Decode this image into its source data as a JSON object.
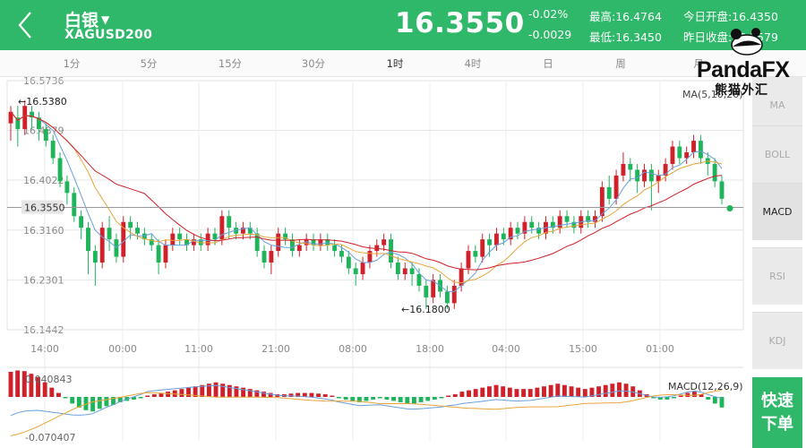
{
  "header": {
    "name": "白银",
    "code": "XAGUSD200",
    "price": "16.3550",
    "change_pct": "-0.02%",
    "change_abs": "-0.0029",
    "high_label": "最高:",
    "high": "16.4764",
    "low_label": "最低:",
    "low": "16.3450",
    "open_label": "今日开盘:",
    "open": "16.4350",
    "prev_close_label": "昨日收盘:",
    "prev_close": "16.3579"
  },
  "tabs": [
    "1分",
    "5分",
    "15分",
    "30分",
    "1时",
    "4时",
    "日",
    "周",
    "月"
  ],
  "active_tab": "1时",
  "logo": {
    "brand": "PandaFX",
    "brand_cn": "熊猫外汇"
  },
  "side_buttons": [
    "MA",
    "BOLL",
    "MACD",
    "RSI",
    "KDJ"
  ],
  "active_side": "MACD",
  "quick_order": [
    "快速",
    "下单"
  ],
  "colors": {
    "accent": "#2fb86a",
    "up": "#d0202a",
    "down": "#1db45a",
    "ma5": "#6aa0dc",
    "ma10": "#e8a53a",
    "ma20": "#d0202a"
  },
  "chart_data": {
    "type": "candlestick",
    "y_ticks": [
      "16.5736",
      "16.4879",
      "16.4022",
      "16.3160",
      "16.2301",
      "16.1442"
    ],
    "ylim": [
      16.1442,
      16.5736
    ],
    "x_ticks": [
      "14:00",
      "00:00",
      "11:00",
      "21:00",
      "08:00",
      "18:00",
      "04:00",
      "15:00",
      "01:00"
    ],
    "current_price_label": "16.3550",
    "current_price": 16.355,
    "max_label": "←16.5380",
    "min_label": "←16.1800",
    "ma_label": "MA(5,10,20)",
    "macd_label": "MACD(12,26,9)",
    "macd_top_label": "0.040843",
    "macd_bottom_label": "-0.070407",
    "candles": [
      [
        16.5,
        16.52,
        16.47,
        16.53
      ],
      [
        16.51,
        16.49,
        16.46,
        16.53
      ],
      [
        16.49,
        16.53,
        16.48,
        16.54
      ],
      [
        16.52,
        16.51,
        16.49,
        16.53
      ],
      [
        16.51,
        16.49,
        16.47,
        16.52
      ],
      [
        16.49,
        16.47,
        16.46,
        16.5
      ],
      [
        16.47,
        16.44,
        16.43,
        16.48
      ],
      [
        16.44,
        16.4,
        16.39,
        16.45
      ],
      [
        16.4,
        16.38,
        16.36,
        16.41
      ],
      [
        16.38,
        16.34,
        16.33,
        16.39
      ],
      [
        16.34,
        16.32,
        16.3,
        16.35
      ],
      [
        16.32,
        16.28,
        16.24,
        16.33
      ],
      [
        16.28,
        16.26,
        16.22,
        16.29
      ],
      [
        16.26,
        16.32,
        16.25,
        16.33
      ],
      [
        16.32,
        16.3,
        16.28,
        16.34
      ],
      [
        16.3,
        16.27,
        16.26,
        16.31
      ],
      [
        16.27,
        16.33,
        16.26,
        16.34
      ],
      [
        16.33,
        16.32,
        16.3,
        16.34
      ],
      [
        16.32,
        16.31,
        16.3,
        16.33
      ],
      [
        16.31,
        16.3,
        16.29,
        16.32
      ],
      [
        16.3,
        16.29,
        16.28,
        16.31
      ],
      [
        16.29,
        16.26,
        16.24,
        16.3
      ],
      [
        16.26,
        16.29,
        16.25,
        16.3
      ],
      [
        16.29,
        16.31,
        16.28,
        16.32
      ],
      [
        16.31,
        16.3,
        16.29,
        16.32
      ],
      [
        16.3,
        16.29,
        16.28,
        16.31
      ],
      [
        16.29,
        16.3,
        16.28,
        16.31
      ],
      [
        16.3,
        16.29,
        16.28,
        16.31
      ],
      [
        16.29,
        16.31,
        16.28,
        16.32
      ],
      [
        16.31,
        16.3,
        16.29,
        16.32
      ],
      [
        16.3,
        16.34,
        16.29,
        16.35
      ],
      [
        16.34,
        16.32,
        16.3,
        16.35
      ],
      [
        16.32,
        16.31,
        16.3,
        16.33
      ],
      [
        16.31,
        16.32,
        16.3,
        16.33
      ],
      [
        16.32,
        16.31,
        16.3,
        16.33
      ],
      [
        16.31,
        16.28,
        16.27,
        16.32
      ],
      [
        16.28,
        16.26,
        16.25,
        16.29
      ],
      [
        16.26,
        16.28,
        16.24,
        16.29
      ],
      [
        16.28,
        16.31,
        16.27,
        16.32
      ],
      [
        16.31,
        16.3,
        16.29,
        16.32
      ],
      [
        16.3,
        16.28,
        16.27,
        16.31
      ],
      [
        16.28,
        16.29,
        16.27,
        16.3
      ],
      [
        16.29,
        16.3,
        16.28,
        16.31
      ],
      [
        16.3,
        16.29,
        16.28,
        16.31
      ],
      [
        16.29,
        16.3,
        16.28,
        16.31
      ],
      [
        16.3,
        16.29,
        16.28,
        16.31
      ],
      [
        16.29,
        16.28,
        16.27,
        16.3
      ],
      [
        16.28,
        16.27,
        16.26,
        16.29
      ],
      [
        16.27,
        16.25,
        16.24,
        16.28
      ],
      [
        16.25,
        16.24,
        16.22,
        16.26
      ],
      [
        16.24,
        16.26,
        16.23,
        16.27
      ],
      [
        16.26,
        16.28,
        16.25,
        16.29
      ],
      [
        16.28,
        16.29,
        16.27,
        16.3
      ],
      [
        16.29,
        16.3,
        16.28,
        16.31
      ],
      [
        16.3,
        16.26,
        16.25,
        16.31
      ],
      [
        16.26,
        16.24,
        16.23,
        16.27
      ],
      [
        16.24,
        16.25,
        16.23,
        16.26
      ],
      [
        16.25,
        16.24,
        16.22,
        16.26
      ],
      [
        16.24,
        16.22,
        16.21,
        16.25
      ],
      [
        16.22,
        16.2,
        16.18,
        16.23
      ],
      [
        16.2,
        16.23,
        16.19,
        16.24
      ],
      [
        16.23,
        16.21,
        16.2,
        16.24
      ],
      [
        16.21,
        16.19,
        16.18,
        16.22
      ],
      [
        16.19,
        16.22,
        16.18,
        16.23
      ],
      [
        16.22,
        16.25,
        16.21,
        16.26
      ],
      [
        16.25,
        16.28,
        16.24,
        16.29
      ],
      [
        16.28,
        16.27,
        16.26,
        16.29
      ],
      [
        16.27,
        16.3,
        16.26,
        16.31
      ],
      [
        16.3,
        16.29,
        16.27,
        16.31
      ],
      [
        16.29,
        16.31,
        16.28,
        16.32
      ],
      [
        16.31,
        16.3,
        16.29,
        16.32
      ],
      [
        16.3,
        16.32,
        16.29,
        16.33
      ],
      [
        16.32,
        16.31,
        16.3,
        16.33
      ],
      [
        16.31,
        16.33,
        16.3,
        16.34
      ],
      [
        16.33,
        16.32,
        16.31,
        16.34
      ],
      [
        16.32,
        16.31,
        16.3,
        16.33
      ],
      [
        16.31,
        16.33,
        16.3,
        16.34
      ],
      [
        16.33,
        16.32,
        16.31,
        16.34
      ],
      [
        16.32,
        16.34,
        16.31,
        16.35
      ],
      [
        16.34,
        16.33,
        16.32,
        16.35
      ],
      [
        16.33,
        16.32,
        16.31,
        16.34
      ],
      [
        16.32,
        16.34,
        16.31,
        16.35
      ],
      [
        16.34,
        16.33,
        16.32,
        16.35
      ],
      [
        16.33,
        16.34,
        16.32,
        16.35
      ],
      [
        16.34,
        16.39,
        16.33,
        16.4
      ],
      [
        16.39,
        16.37,
        16.36,
        16.41
      ],
      [
        16.37,
        16.41,
        16.36,
        16.42
      ],
      [
        16.41,
        16.43,
        16.4,
        16.45
      ],
      [
        16.43,
        16.42,
        16.4,
        16.44
      ],
      [
        16.42,
        16.4,
        16.38,
        16.43
      ],
      [
        16.4,
        16.42,
        16.39,
        16.43
      ],
      [
        16.42,
        16.4,
        16.35,
        16.43
      ],
      [
        16.4,
        16.41,
        16.38,
        16.42
      ],
      [
        16.41,
        16.43,
        16.4,
        16.44
      ],
      [
        16.43,
        16.46,
        16.42,
        16.47
      ],
      [
        16.46,
        16.44,
        16.43,
        16.47
      ],
      [
        16.44,
        16.45,
        16.43,
        16.46
      ],
      [
        16.45,
        16.47,
        16.44,
        16.48
      ],
      [
        16.47,
        16.44,
        16.43,
        16.48
      ],
      [
        16.44,
        16.43,
        16.41,
        16.45
      ],
      [
        16.43,
        16.4,
        16.39,
        16.44
      ],
      [
        16.4,
        16.37,
        16.36,
        16.41
      ]
    ],
    "macd_hist": [
      0.038,
      0.04,
      0.039,
      0.035,
      0.03,
      0.022,
      0.014,
      0.006,
      -0.002,
      -0.01,
      -0.016,
      -0.02,
      -0.022,
      -0.018,
      -0.014,
      -0.012,
      -0.008,
      -0.006,
      -0.004,
      -0.002,
      0.002,
      0.004,
      0.006,
      0.008,
      0.01,
      0.012,
      0.014,
      0.016,
      0.018,
      0.02,
      0.022,
      0.02,
      0.018,
      0.016,
      0.014,
      0.012,
      0.01,
      0.008,
      0.006,
      0.004,
      0.004,
      0.005,
      0.006,
      0.006,
      0.006,
      0.005,
      0.004,
      0.002,
      -0.002,
      -0.004,
      -0.006,
      -0.008,
      -0.006,
      -0.004,
      -0.002,
      -0.004,
      -0.006,
      -0.008,
      -0.01,
      -0.01,
      -0.008,
      -0.006,
      -0.004,
      -0.002,
      0.002,
      0.004,
      0.008,
      0.01,
      0.012,
      0.014,
      0.016,
      0.018,
      0.016,
      0.014,
      0.012,
      0.012,
      0.012,
      0.014,
      0.016,
      0.018,
      0.02,
      0.018,
      0.016,
      0.014,
      0.012,
      0.014,
      0.016,
      0.018,
      0.02,
      0.022,
      0.02,
      0.016,
      0.01,
      0.004,
      -0.002,
      -0.004,
      -0.004,
      -0.002,
      0.002,
      0.006,
      0.008,
      0.004,
      -0.004,
      -0.01,
      -0.016
    ]
  }
}
